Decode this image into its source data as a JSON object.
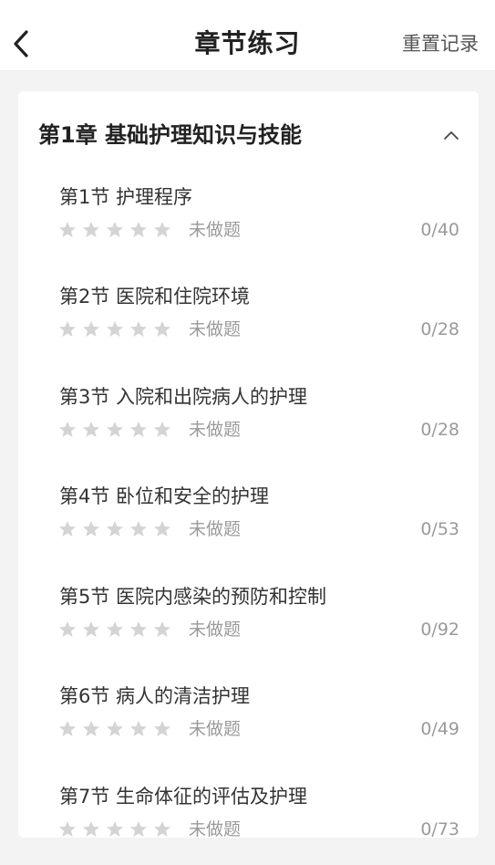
{
  "header": {
    "title": "章节练习",
    "reset_label": "重置记录"
  },
  "chapter": {
    "title": "第1章 基础护理知识与技能",
    "expanded": true
  },
  "rating": {
    "max_stars": 5,
    "filled_stars": 0,
    "star_color": "#d4d4d4"
  },
  "sections": [
    {
      "label": "第1节 护理程序",
      "status": "未做题",
      "progress": "0/40"
    },
    {
      "label": "第2节 医院和住院环境",
      "status": "未做题",
      "progress": "0/28"
    },
    {
      "label": "第3节 入院和出院病人的护理",
      "status": "未做题",
      "progress": "0/28"
    },
    {
      "label": "第4节 卧位和安全的护理",
      "status": "未做题",
      "progress": "0/53"
    },
    {
      "label": "第5节 医院内感染的预防和控制",
      "status": "未做题",
      "progress": "0/92"
    },
    {
      "label": "第6节 病人的清洁护理",
      "status": "未做题",
      "progress": "0/49"
    },
    {
      "label": "第7节 生命体征的评估及护理",
      "status": "未做题",
      "progress": "0/73"
    }
  ]
}
